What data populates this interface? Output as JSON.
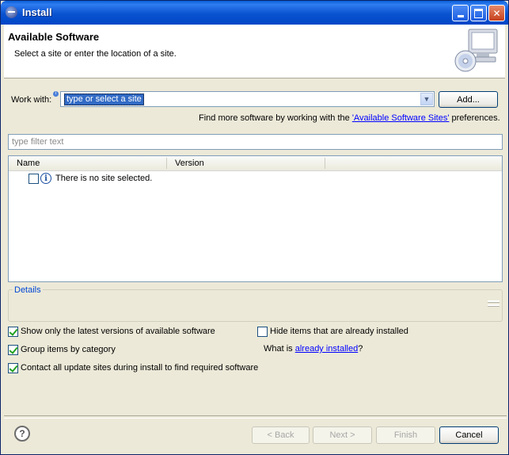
{
  "window": {
    "title": "Install"
  },
  "header": {
    "title": "Available Software",
    "description": "Select a site or enter the location of a site."
  },
  "work_with": {
    "label": "Work with:",
    "value": "type or select a site",
    "add_button": "Add...",
    "more_prefix": "Find more software by working with the ",
    "more_link": "'Available Software Sites'",
    "more_suffix": " preferences."
  },
  "filter": {
    "placeholder": "type filter text"
  },
  "table": {
    "columns": [
      "Name",
      "Version"
    ],
    "rows": [
      {
        "text": "There is no site selected."
      }
    ]
  },
  "details": {
    "label": "Details"
  },
  "options": {
    "latest_versions": {
      "label": "Show only the latest versions of available software",
      "checked": true
    },
    "group_by_category": {
      "label": "Group items by category",
      "checked": true
    },
    "contact_sites": {
      "label": "Contact all update sites during install to find required software",
      "checked": true
    },
    "hide_installed": {
      "label": "Hide items that are already installed",
      "checked": false
    },
    "what_is_prefix": "What is ",
    "what_is_link": "already installed",
    "what_is_suffix": "?"
  },
  "buttons": {
    "back": "< Back",
    "next": "Next >",
    "finish": "Finish",
    "cancel": "Cancel"
  }
}
